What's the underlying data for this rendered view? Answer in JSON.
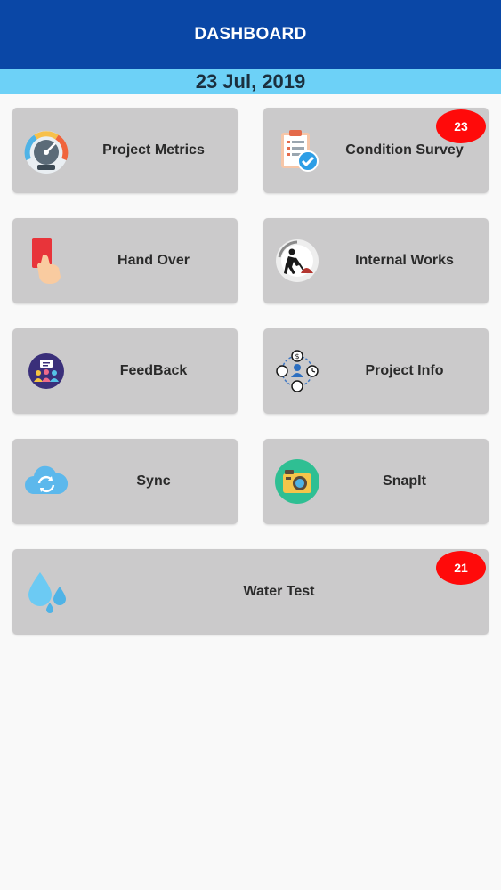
{
  "header": {
    "title": "DASHBOARD"
  },
  "date": "23 Jul, 2019",
  "tiles": [
    {
      "label": "Project Metrics",
      "icon": "gauge-icon"
    },
    {
      "label": "Condition Survey",
      "icon": "clipboard-check-icon",
      "badge": "23"
    },
    {
      "label": "Hand Over",
      "icon": "hand-card-icon"
    },
    {
      "label": "Internal Works",
      "icon": "construction-worker-icon"
    },
    {
      "label": "FeedBack",
      "icon": "feedback-people-icon"
    },
    {
      "label": "Project Info",
      "icon": "project-network-icon"
    },
    {
      "label": "Sync",
      "icon": "cloud-sync-icon"
    },
    {
      "label": "SnapIt",
      "icon": "camera-icon"
    },
    {
      "label": "Water Test",
      "icon": "water-drops-icon",
      "badge": "21"
    }
  ],
  "colors": {
    "app_bar": "#0a47a6",
    "date_strip": "#6dd1f7",
    "tile": "#cbcacb",
    "badge": "#ff0a0a"
  }
}
